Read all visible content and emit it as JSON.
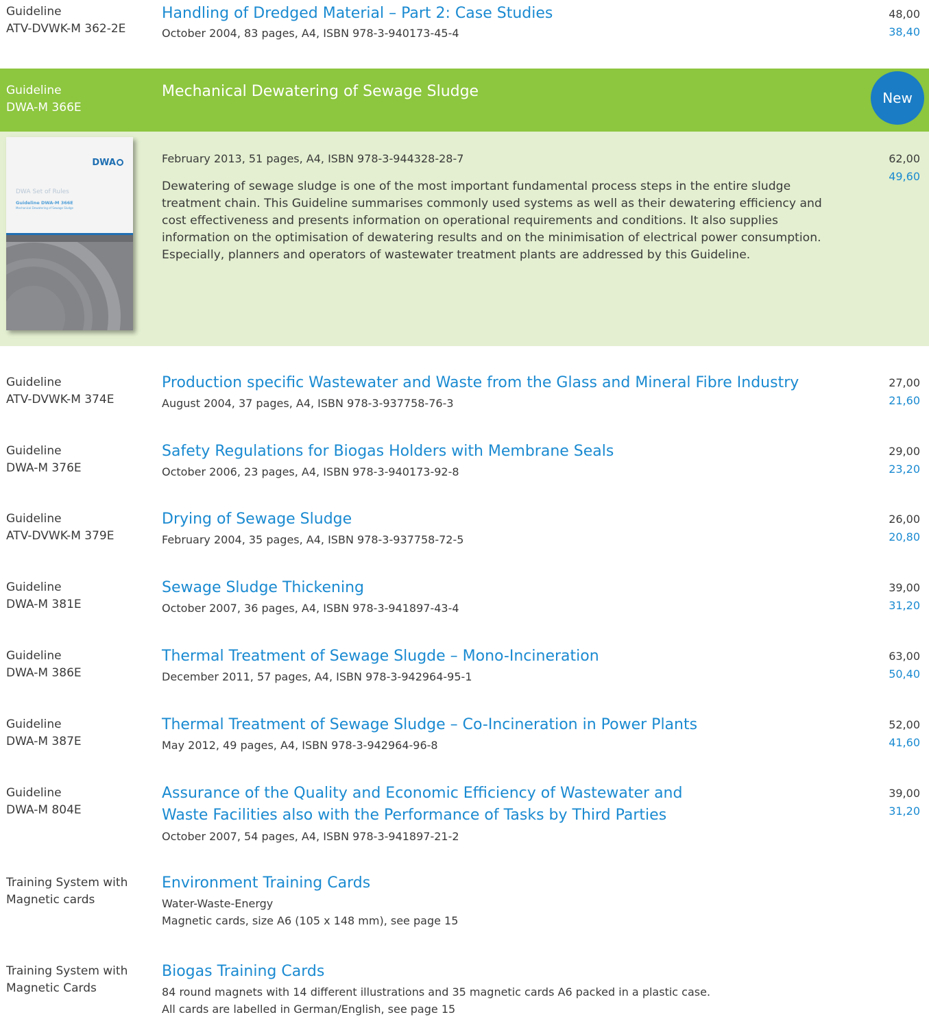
{
  "entries_top": [
    {
      "category": [
        "Guideline",
        "ATV-DVWK-M 362-2E"
      ],
      "title": [
        "Handling of Dredged Material – Part 2: Case Studies"
      ],
      "meta": [
        "October 2004, 83 pages, A4, ISBN 978-3-940173-45-4"
      ],
      "price": "48,00",
      "member_price": "38,40"
    }
  ],
  "featured": {
    "category": [
      "Guideline",
      "DWA-M 366E"
    ],
    "title": "Mechanical Dewatering of Sewage Sludge",
    "badge": "New",
    "meta": "February 2013, 51 pages, A4, ISBN 978-3-944328-28-7",
    "price": "62,00",
    "member_price": "49,60",
    "description": "Dewatering of sewage sludge is one of the most important fundamental process steps in the entire sludge treatment chain. This Guideline summarises commonly used systems as well as their dewatering efficiency and cost effectiveness and presents information on operational requirements and conditions. It also supplies information on the optimisation of dewatering results and on the minimisation of electrical power consumption. Especially, planners and operators of wastewater treatment plants are addressed by this Guideline.",
    "cover": {
      "logo": "DWA",
      "series": "DWA Set of Rules",
      "guideline": "Guideline DWA-M 366E",
      "subtitle": "Mechanical Dewatering of Sewage Sludge"
    }
  },
  "entries": [
    {
      "category": [
        "Guideline",
        "ATV-DVWK-M 374E"
      ],
      "title": [
        "Production specific Wastewater and Waste from the Glass and Mineral Fibre Industry"
      ],
      "meta": [
        "August 2004, 37 pages, A4, ISBN 978-3-937758-76-3"
      ],
      "price": "27,00",
      "member_price": "21,60"
    },
    {
      "category": [
        "Guideline",
        "DWA-M 376E"
      ],
      "title": [
        "Safety Regulations for Biogas Holders with Membrane Seals"
      ],
      "meta": [
        "October 2006, 23 pages, A4, ISBN 978-3-940173-92-8"
      ],
      "price": "29,00",
      "member_price": "23,20"
    },
    {
      "category": [
        "Guideline",
        "ATV-DVWK-M 379E"
      ],
      "title": [
        "Drying of Sewage Sludge"
      ],
      "meta": [
        "February 2004, 35 pages, A4, ISBN 978-3-937758-72-5"
      ],
      "price": "26,00",
      "member_price": "20,80"
    },
    {
      "category": [
        "Guideline",
        "DWA-M 381E"
      ],
      "title": [
        "Sewage Sludge Thickening"
      ],
      "meta": [
        "October 2007, 36 pages, A4, ISBN 978-3-941897-43-4"
      ],
      "price": "39,00",
      "member_price": "31,20"
    },
    {
      "category": [
        "Guideline",
        "DWA-M 386E"
      ],
      "title": [
        "Thermal Treatment of Sewage Slugde – Mono-Incineration"
      ],
      "meta": [
        "December 2011, 57 pages, A4, ISBN 978-3-942964-95-1"
      ],
      "price": "63,00",
      "member_price": "50,40"
    },
    {
      "category": [
        "Guideline",
        "DWA-M 387E"
      ],
      "title": [
        "Thermal Treatment of Sewage Sludge – Co-Incineration in Power Plants"
      ],
      "meta": [
        "May 2012, 49 pages, A4, ISBN 978-3-942964-96-8"
      ],
      "price": "52,00",
      "member_price": "41,60"
    },
    {
      "category": [
        "Guideline",
        "DWA-M 804E"
      ],
      "title": [
        "Assurance of the Quality and Economic Efficiency of Wastewater and",
        "Waste Facilities also with the Performance of Tasks by Third Parties"
      ],
      "meta": [
        "October 2007, 54 pages, A4, ISBN 978-3-941897-21-2"
      ],
      "price": "39,00",
      "member_price": "31,20"
    },
    {
      "category": [
        "Training System with",
        "Magnetic cards"
      ],
      "title": [
        "Environment Training Cards"
      ],
      "meta": [
        "Water-Waste-Energy",
        "Magnetic cards, size A6 (105 x 148 mm), see page 15"
      ]
    },
    {
      "category": [
        "Training System with",
        "Magnetic Cards"
      ],
      "title": [
        "Biogas Training Cards"
      ],
      "meta": [
        "84 round magnets with 14 different illustrations and 35 magnetic cards A6 packed in a plastic case.",
        "All cards are labelled in German/English, see page 15"
      ]
    }
  ],
  "colors": {
    "link_blue": "#1a8ad1",
    "band_green": "#8dc63f",
    "panel_green": "#e3efd0",
    "badge_blue": "#1a7cc4"
  }
}
